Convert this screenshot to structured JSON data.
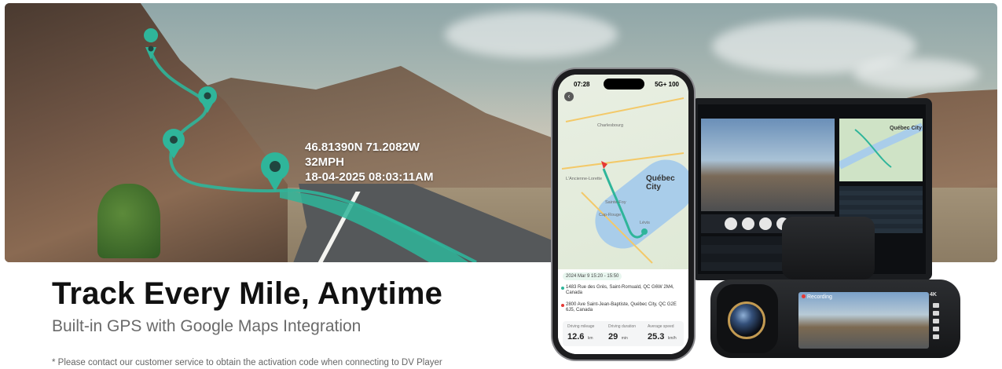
{
  "hero": {
    "gps_readout": {
      "coordinates": "46.81390N 71.2082W",
      "speed": "32MPH",
      "timestamp": "18-04-2025 08:03:11AM"
    },
    "route_color": "#2fb59a"
  },
  "headline": "Track Every Mile, Anytime",
  "subheadline": "Built-in GPS with Google Maps Integration",
  "footnote": "* Please contact our customer service to obtain the activation code when connecting to DV Player",
  "phone": {
    "status_time": "07:28",
    "status_right": "5G+ 100",
    "map_city": "Québec City",
    "map_labels": [
      "Charlesbourg",
      "L'Ancienne-Lorette",
      "Lévis",
      "Sainte-Foy",
      "Cap-Rouge"
    ],
    "trip": {
      "date": "2024 Mar 9 15:20 - 15:50",
      "start": "1483 Rue des Grès, Saint-Romuald, QC G6W 2M4, Canada",
      "end": "2800 Ave Saint-Jean-Baptiste, Québec City, QC G2E 6J5, Canada",
      "stats": [
        {
          "label": "Driving mileage",
          "value": "12.6",
          "unit": "km"
        },
        {
          "label": "Driving duration",
          "value": "29",
          "unit": "min"
        },
        {
          "label": "Average speed",
          "value": "25.3",
          "unit": "km/h"
        }
      ]
    }
  },
  "monitor": {
    "map_city": "Québec City"
  },
  "dashcam": {
    "rec_label": "Recording",
    "badge": "4K"
  }
}
